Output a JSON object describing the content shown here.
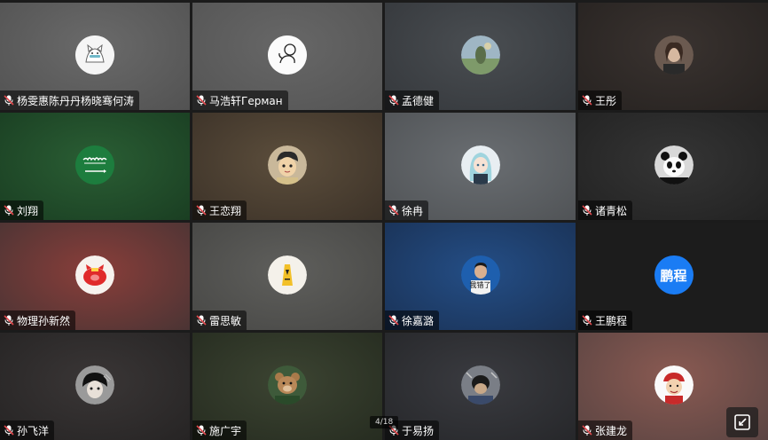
{
  "meeting": {
    "page_indicator": "4/18"
  },
  "participants": [
    {
      "name": "杨雯惠陈丹丹杨晓骞何涛",
      "avatar_icon": "cat-cartoon-icon",
      "bg": "#5e5e5e",
      "mic": "muted"
    },
    {
      "name": "马浩轩Герман",
      "avatar_icon": "doodle-character-icon",
      "bg": "#5c5c5c",
      "mic": "muted"
    },
    {
      "name": "孟德健",
      "avatar_icon": "painting-photo-icon",
      "bg": "#3e4145",
      "mic": "muted"
    },
    {
      "name": "王彤",
      "avatar_icon": "person-photo-icon",
      "bg": "#2f2a28",
      "mic": "muted"
    },
    {
      "name": "刘翔",
      "avatar_icon": "saudi-flag-icon",
      "bg": "#1f4a28",
      "mic": "muted"
    },
    {
      "name": "王恋翔",
      "avatar_icon": "anime-boy-icon",
      "bg": "#4a3f33",
      "mic": "muted"
    },
    {
      "name": "徐冉",
      "avatar_icon": "anime-girl-icon",
      "bg": "#5a5d60",
      "mic": "muted"
    },
    {
      "name": "诸青松",
      "avatar_icon": "panda-icon",
      "bg": "#2b2b2b",
      "mic": "muted"
    },
    {
      "name": "物理孙新然",
      "avatar_icon": "red-pig-icon",
      "bg": "#6a3a38",
      "mic": "muted"
    },
    {
      "name": "雷思敏",
      "avatar_icon": "wet-floor-sign-icon",
      "bg": "#4f4f4d",
      "mic": "muted"
    },
    {
      "name": "徐嘉潞",
      "avatar_icon": "person-caption-icon",
      "avatar_caption": "我错了",
      "bg": "#1e4170",
      "mic": "muted"
    },
    {
      "name": "王鹏程",
      "avatar_icon": "text-avatar-icon",
      "avatar_text": "鹏程",
      "bg": "#1c1c1c",
      "mic": "muted"
    },
    {
      "name": "孙飞洋",
      "avatar_icon": "dark-anime-icon",
      "bg": "#2c2a2a",
      "mic": "muted"
    },
    {
      "name": "施广宇",
      "avatar_icon": "teddy-bear-icon",
      "bg": "#2e3527",
      "mic": "muted"
    },
    {
      "name": "于易扬",
      "avatar_icon": "person-photo-icon",
      "bg": "#2f3034",
      "mic": "muted"
    },
    {
      "name": "张建龙",
      "avatar_icon": "one-piece-character-icon",
      "bg": "#6a4440",
      "mic": "muted"
    }
  ],
  "colors": {
    "label_bg": "rgba(0,0,0,0.55)",
    "mic_muted": "#e0474c",
    "text_avatar_bg": "#1a7cf4"
  },
  "controls": {
    "fullscreen_icon": "exit-fullscreen-icon"
  }
}
